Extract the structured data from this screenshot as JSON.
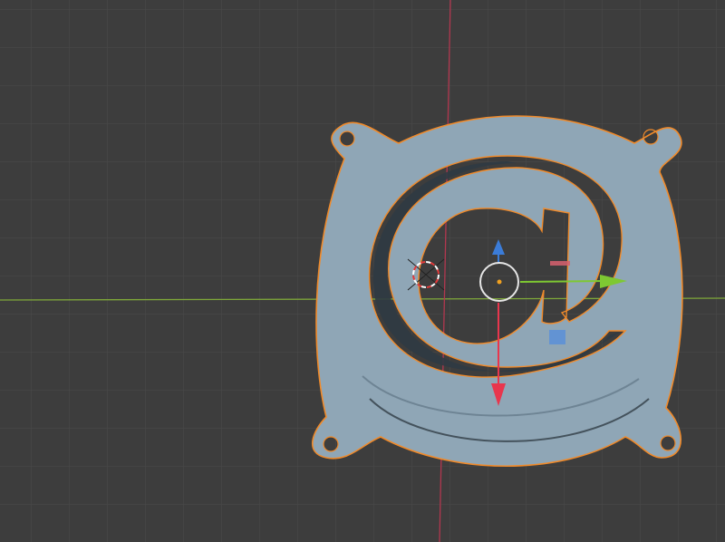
{
  "viewport": {
    "mode": "3d-viewport-object-selected",
    "background_color": "#3d3d3d",
    "grid_color": "#4a4a4a",
    "x_axis_color": "#7fa83a",
    "y_axis_color": "#b2374f"
  },
  "object": {
    "shape": "fan-guard-with-at-sign",
    "fill_color": "#8fa6b6",
    "shadow_color": "#5a6b78",
    "outline_color": "#f08a2a",
    "mounting_holes": 4
  },
  "gizmo": {
    "type": "move-transform",
    "x_arrow_color": "#7ec832",
    "y_arrow_color": "#e8364d",
    "z_arrow_color": "#3b7cd8",
    "plane_handle_color": "#5b8fd8",
    "center_ring_color": "#e6e6e6",
    "origin_color": "#f0a020"
  },
  "cursor_3d": {
    "icon": "3d-cursor-icon",
    "ring_color": "#ffffff",
    "accent_color": "#e23a3a"
  }
}
